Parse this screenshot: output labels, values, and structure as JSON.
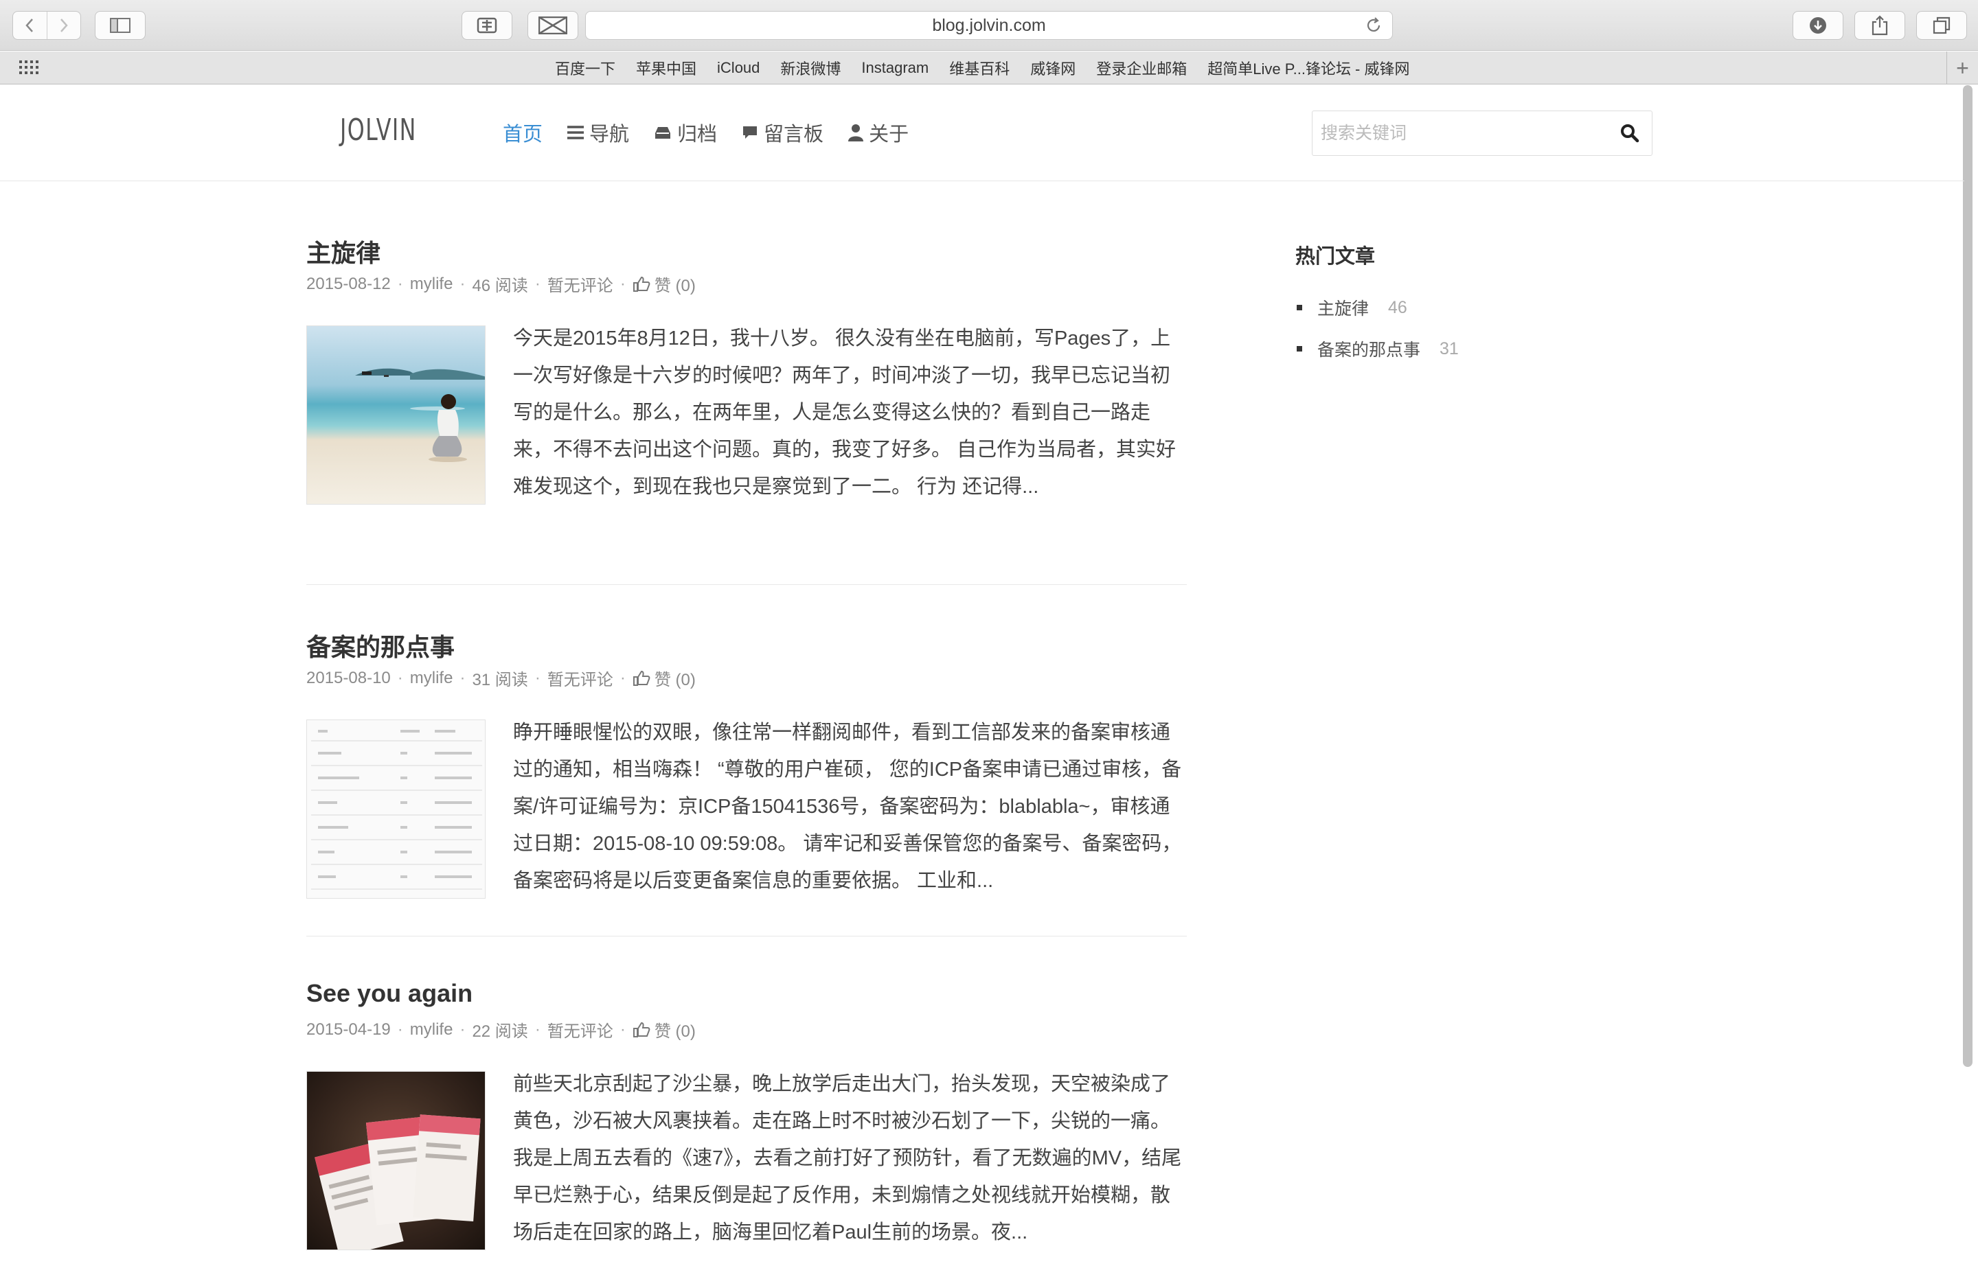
{
  "browser": {
    "url": "blog.jolvin.com",
    "favorites": [
      "百度一下",
      "苹果中国",
      "iCloud",
      "新浪微博",
      "Instagram",
      "维基百科",
      "威锋网",
      "登录企业邮箱",
      "超简单Live P...锋论坛 - 威锋网"
    ]
  },
  "site": {
    "logo": "JOLVIN",
    "nav": [
      {
        "label": "首页",
        "icon": "",
        "active": true
      },
      {
        "label": "导航",
        "icon": "menu-icon"
      },
      {
        "label": "归档",
        "icon": "archive-icon"
      },
      {
        "label": "留言板",
        "icon": "comment-icon"
      },
      {
        "label": "关于",
        "icon": "user-icon"
      }
    ],
    "search_placeholder": "搜索关键词"
  },
  "posts": [
    {
      "title": "主旋律",
      "date": "2015-08-12",
      "category": "mylife",
      "reads": "46 阅读",
      "comments": "暂无评论",
      "likes": "赞 (0)",
      "thumb": "beach",
      "excerpt": "今天是2015年8月12日，我十八岁。 很久没有坐在电脑前，写Pages了，上一次写好像是十六岁的时候吧？两年了，时间冲淡了一切，我早已忘记当初写的是什么。那么，在两年里，人是怎么变得这么快的？看到自己一路走来，不得不去问出这个问题。真的，我变了好多。 自己作为当局者，其实好难发现这个，到现在我也只是察觉到了一二。 行为 还记得..."
    },
    {
      "title": "备案的那点事",
      "date": "2015-08-10",
      "category": "mylife",
      "reads": "31 阅读",
      "comments": "暂无评论",
      "likes": "赞 (0)",
      "thumb": "table",
      "excerpt": "睁开睡眼惺忪的双眼，像往常一样翻阅邮件，看到工信部发来的备案审核通过的通知，相当嗨森！ “尊敬的用户崔硕， 您的ICP备案申请已通过审核，备案/许可证编号为：京ICP备15041536号，备案密码为：blablabla~，审核通过日期：2015-08-10 09:59:08。 请牢记和妥善保管您的备案号、备案密码，备案密码将是以后变更备案信息的重要依据。 工业和..."
    },
    {
      "title": "See you again",
      "date": "2015-04-19",
      "category": "mylife",
      "reads": "22 阅读",
      "comments": "暂无评论",
      "likes": "赞 (0)",
      "thumb": "ticket",
      "excerpt": "前些天北京刮起了沙尘暴，晚上放学后走出大门，抬头发现，天空被染成了黄色，沙石被大风裹挟着。走在路上时不时被沙石划了一下，尖锐的一痛。 我是上周五去看的《速7》，去看之前打好了预防针，看了无数遍的MV，结尾早已烂熟于心，结果反倒是起了反作用，未到煽情之处视线就开始模糊，散场后走在回家的路上，脑海里回忆着Paul生前的场景。夜..."
    }
  ],
  "sidebar": {
    "title": "热门文章",
    "items": [
      {
        "label": "主旋律",
        "count": "46"
      },
      {
        "label": "备案的那点事",
        "count": "31"
      }
    ]
  },
  "colors": {
    "accent": "#3a8ed3"
  }
}
